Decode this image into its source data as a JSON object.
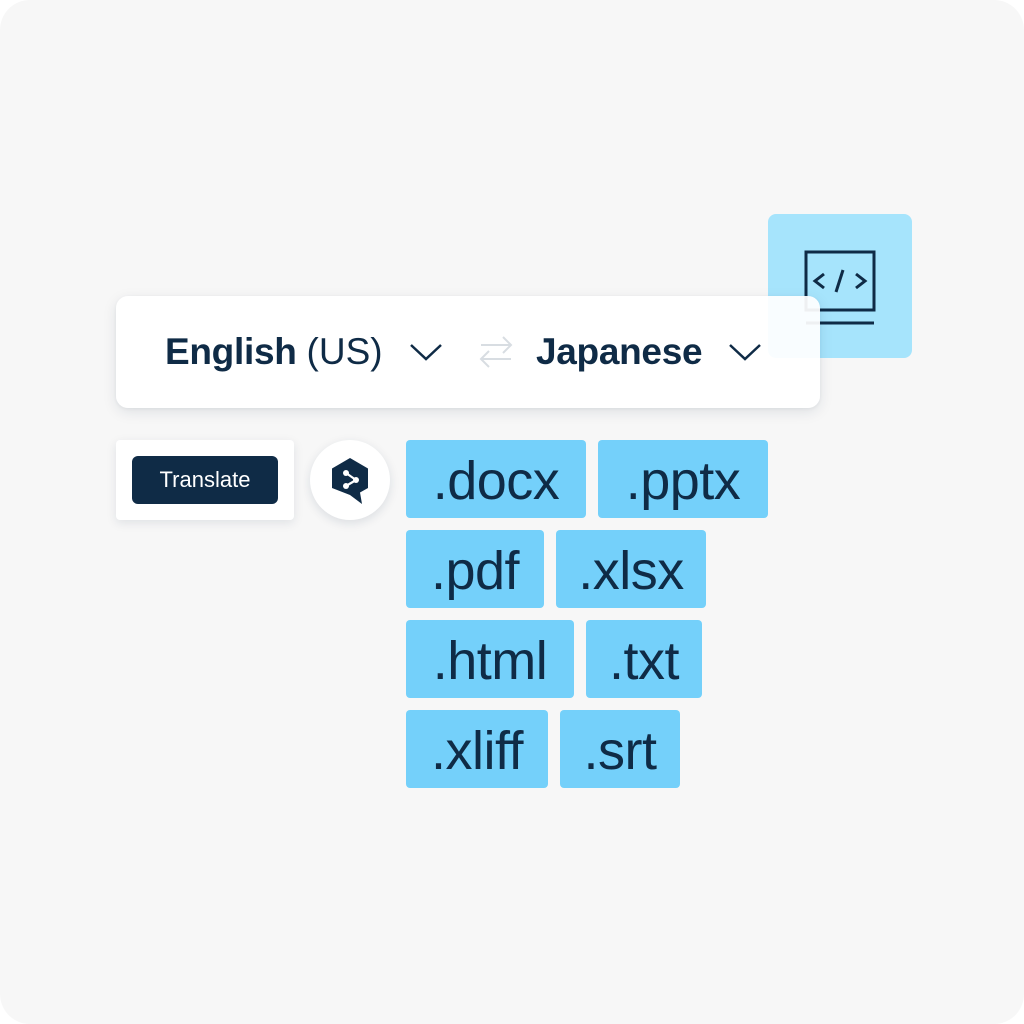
{
  "colors": {
    "background": "#f7f7f7",
    "navy": "#0f2b46",
    "chip_blue": "#74d0fa",
    "tile_blue": "#a6e4fc",
    "white": "#ffffff"
  },
  "language_bar": {
    "source_language": "English",
    "source_variant": "(US)",
    "target_language": "Japanese",
    "source_dropdown_icon": "chevron-down-icon",
    "swap_icon": "swap-arrows-icon",
    "target_dropdown_icon": "chevron-down-icon"
  },
  "translate_button_label": "Translate",
  "logo": {
    "icon": "deepl-logo-icon"
  },
  "code_tile": {
    "icon": "code-window-icon"
  },
  "file_formats": [
    ".docx",
    ".pptx",
    ".pdf",
    ".xlsx",
    ".html",
    ".txt",
    ".xliff",
    ".srt"
  ]
}
